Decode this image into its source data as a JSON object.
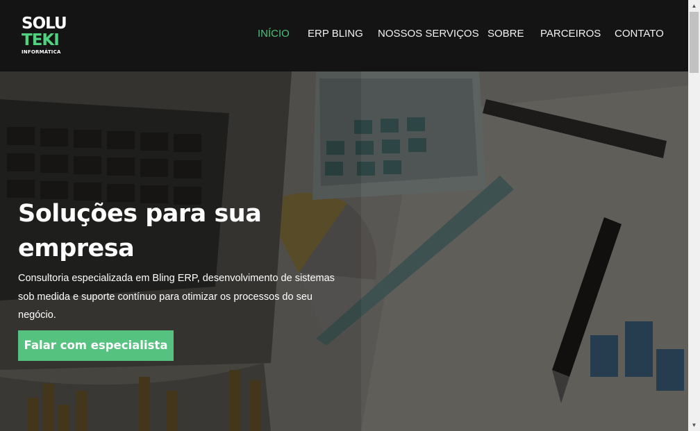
{
  "brand": {
    "line1": "SOLU",
    "line2": "TEKI",
    "line3": "INFORMÁTICA",
    "accent_color": "#4fd17f"
  },
  "nav": {
    "items": [
      {
        "label": "INÍCIO",
        "active": true
      },
      {
        "label": "ERP BLING",
        "active": false
      },
      {
        "label": "NOSSOS SERVIÇOS",
        "active": false
      },
      {
        "label": "SOBRE",
        "active": false
      },
      {
        "label": "PARCEIROS",
        "active": false
      },
      {
        "label": "CONTATO",
        "active": false
      }
    ]
  },
  "hero": {
    "title": "Soluções para sua empresa",
    "text": "Consultoria especializada em Bling ERP, desenvolvimento de sistemas sob medida e suporte contínuo para otimizar os processos do seu negócio.",
    "cta_label": "Falar com especialista",
    "cta_color": "#55c27f",
    "background_image": "desk-photo"
  },
  "scrollbar": {
    "up_icon": "arrow-up-icon",
    "down_icon": "arrow-down-icon"
  }
}
